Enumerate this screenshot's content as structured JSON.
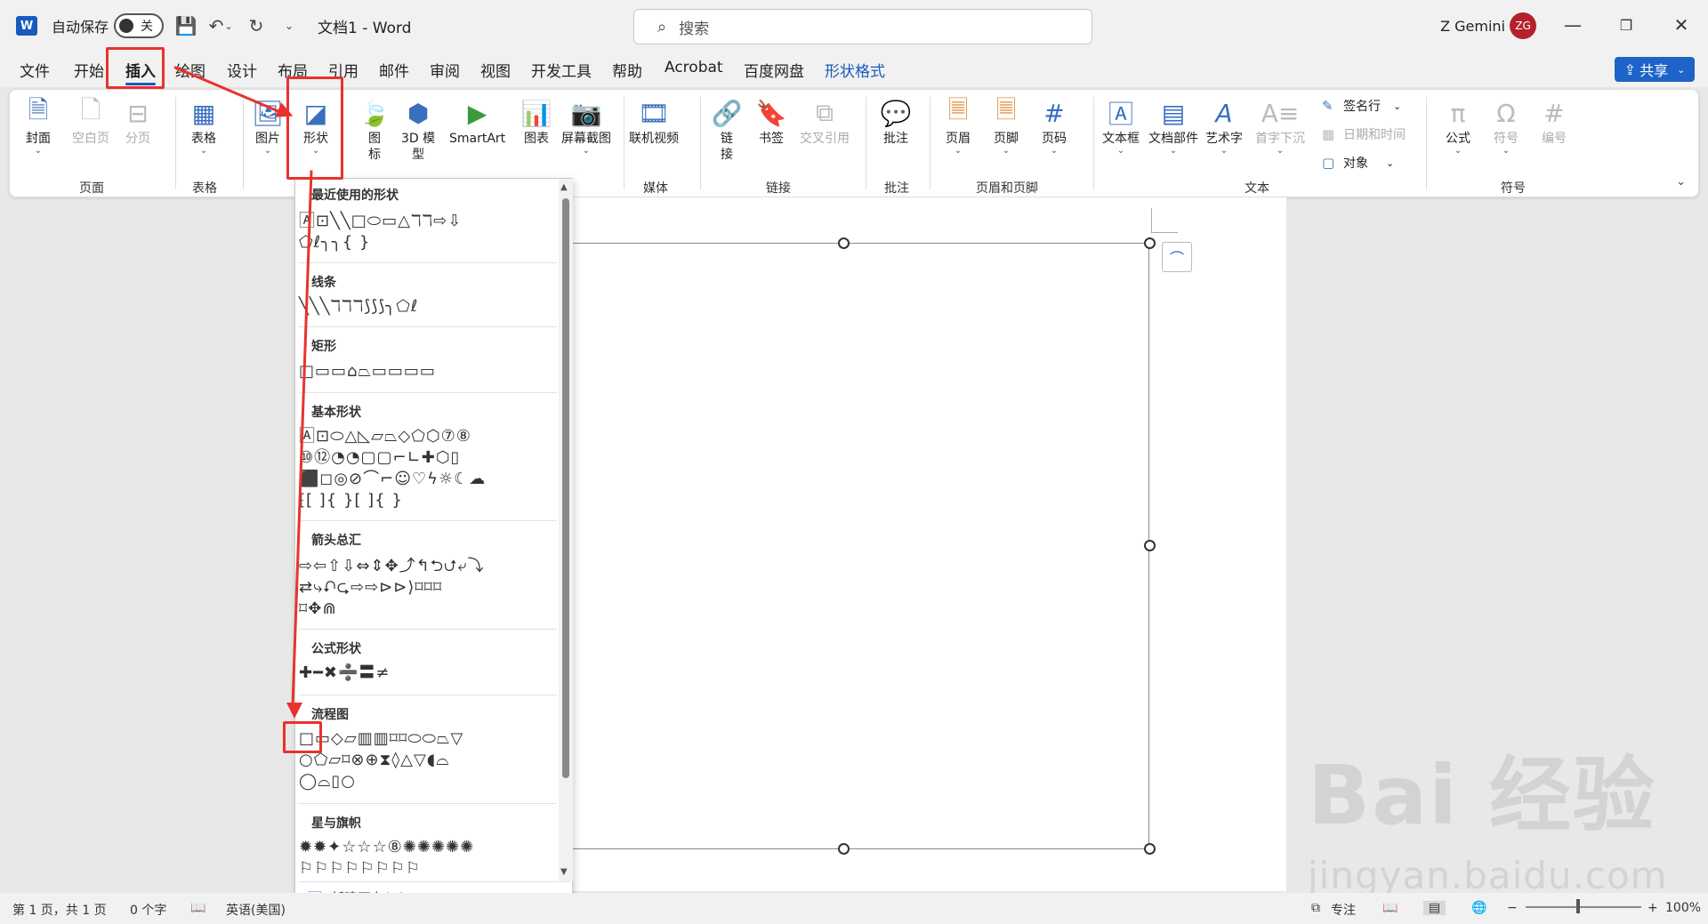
{
  "titlebar": {
    "autosave_label": "自动保存",
    "autosave_state": "关",
    "doc_title": "文档1  -  Word",
    "search_placeholder": "搜索",
    "user_name": "Z Gemini",
    "avatar_initials": "ZG"
  },
  "menu": {
    "tabs": [
      "文件",
      "开始",
      "插入",
      "绘图",
      "设计",
      "布局",
      "引用",
      "邮件",
      "审阅",
      "视图",
      "开发工具",
      "帮助",
      "Acrobat",
      "百度网盘",
      "形状格式"
    ],
    "active": "插入",
    "share_label": "共享"
  },
  "ribbon": {
    "groups": {
      "pages": "页面",
      "tables": "表格",
      "media": "媒体",
      "links": "链接",
      "comments": "批注",
      "header_footer": "页眉和页脚",
      "text": "文本",
      "symbols": "符号"
    },
    "pages": {
      "cover": "封面",
      "blank": "空白页",
      "break": "分页"
    },
    "table": "表格",
    "illustrations": {
      "picture": "图片",
      "shapes": "形状",
      "icons": "图\n标",
      "model3d": "3D 模\n型",
      "smartart": "SmartArt",
      "chart": "图表",
      "screenshot": "屏幕截图"
    },
    "online_video": "联机视频",
    "links": {
      "link": "链\n接",
      "bookmark": "书签",
      "crossref": "交叉引用"
    },
    "comment": "批注",
    "hf": {
      "header": "页眉",
      "footer": "页脚",
      "pagenum": "页码"
    },
    "text": {
      "textbox": "文本框",
      "quickparts": "文档部件",
      "wordart": "艺术字",
      "dropcap": "首字下沉",
      "signature": "签名行",
      "datetime": "日期和时间",
      "object": "对象"
    },
    "symbols": {
      "equation": "公式",
      "symbol": "符号",
      "number": "编号"
    }
  },
  "shapes_menu": {
    "sections": [
      {
        "title": "最近使用的形状",
        "rows": [
          "🄰⊡╲╲□⬭▭△ℸℸ⇨⇩",
          "⬠ℓ╮╮{ }"
        ]
      },
      {
        "title": "线条",
        "rows": [
          "╲╲╲ℸℸℸ⟆⟆⟆╮⬠ℓ"
        ]
      },
      {
        "title": "矩形",
        "rows": [
          "□▭▭⌂⏢▭▭▭▭"
        ]
      },
      {
        "title": "基本形状",
        "rows": [
          "🄰⊡⬭△◺▱⏢◇⬠⬡⑦⑧",
          "⑩⑫◔◔▢▢⌐∟✚⬡▯",
          "⬛◻◎⊘⌒⌐☺♡ϟ☼☾☁",
          "⁅[ ]{ }[ ]{ }"
        ]
      },
      {
        "title": "箭头总汇",
        "rows": [
          "⇨⇦⇧⇩⇔⇕✥⤴↰⮌⮍⤶⤵",
          "⇄⤷⮏⮎⇨⇨⊳⊳⟩⌑⌑⌑",
          "⌑✥⋒"
        ]
      },
      {
        "title": "公式形状",
        "rows": [
          "✚━✖➗〓≠"
        ]
      },
      {
        "title": "流程图",
        "rows": [
          "□▭◇▱▥▥⌑⌑⬭⬭⏢▽",
          "○⬠▱⌑⊗⊕⧗◊△▽◖⌓",
          "◯⌓▯○"
        ]
      },
      {
        "title": "星与旗帜",
        "rows": [
          "✹✹✦☆☆☆⑧✺✺✺✺✺",
          "⚐⚐⚐⚐⚐⚐⚐⚐"
        ]
      }
    ],
    "new_canvas": "新建画布(N)"
  },
  "status": {
    "page": "第 1 页，共 1 页",
    "words": "0 个字",
    "lang": "英语(美国)",
    "focus": "专注",
    "zoom": "100%"
  },
  "watermark": {
    "main": "Bai 经验",
    "sub": "jingyan.baidu.com"
  }
}
